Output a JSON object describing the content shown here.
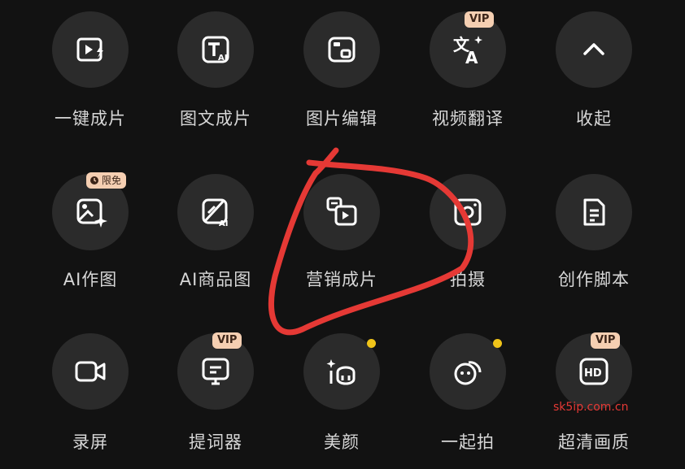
{
  "grid": {
    "row1": [
      {
        "label": "一键成片",
        "icon": "video-flash-icon"
      },
      {
        "label": "图文成片",
        "icon": "text-ai-icon"
      },
      {
        "label": "图片编辑",
        "icon": "image-edit-icon"
      },
      {
        "label": "视频翻译",
        "icon": "translate-icon",
        "badge": "VIP"
      },
      {
        "label": "收起",
        "icon": "chevron-up-icon"
      }
    ],
    "row2": [
      {
        "label": "AI作图",
        "icon": "ai-image-icon",
        "badge": "限免"
      },
      {
        "label": "AI商品图",
        "icon": "ai-product-icon"
      },
      {
        "label": "营销成片",
        "icon": "marketing-video-icon"
      },
      {
        "label": "拍摄",
        "icon": "camera-icon"
      },
      {
        "label": "创作脚本",
        "icon": "script-doc-icon"
      }
    ],
    "row3": [
      {
        "label": "录屏",
        "icon": "screen-record-icon"
      },
      {
        "label": "提词器",
        "icon": "teleprompter-icon",
        "badge": "VIP"
      },
      {
        "label": "美颜",
        "icon": "beauty-icon",
        "dot": true
      },
      {
        "label": "一起拍",
        "icon": "shoot-together-icon",
        "dot": true
      },
      {
        "label": "超清画质",
        "icon": "hd-icon",
        "badge": "VIP"
      }
    ]
  },
  "colors": {
    "background": "#121212",
    "circle": "#2b2b2b",
    "badge": "#f5cfb2",
    "dot": "#f0c419",
    "scribble": "#e53935"
  },
  "watermark": "sk5ip.com.cn"
}
